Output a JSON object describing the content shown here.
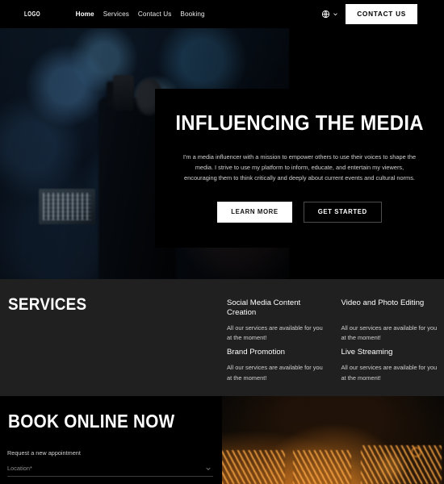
{
  "header": {
    "logo": "LOGO",
    "nav": [
      {
        "label": "Home",
        "active": true
      },
      {
        "label": "Services",
        "active": false
      },
      {
        "label": "Contact Us",
        "active": false
      },
      {
        "label": "Booking",
        "active": false
      }
    ],
    "language_icon": "globe-icon",
    "language_chevron_icon": "chevron-down-icon",
    "cta_label": "CONTACT US"
  },
  "hero": {
    "title": "INFLUENCING THE MEDIA",
    "description": "I'm a media influencer with a mission to empower others to use their voices to shape the media. I strive to use my platform to inform, educate, and entertain my viewers, encouraging them to think critically and deeply about current events and cultural norms.",
    "primary_button": "LEARN MORE",
    "secondary_button": "GET STARTED",
    "image_alt": "blurred-video-camera-bokeh-photo"
  },
  "services": {
    "title": "SERVICES",
    "items": [
      {
        "name": "Social Media Content Creation",
        "description": "All our services are available for you at the moment!"
      },
      {
        "name": "Video and Photo Editing",
        "description": "All our services are available for you at the moment!"
      },
      {
        "name": "Brand Promotion",
        "description": "All our services are available for you at the moment!"
      },
      {
        "name": "Live Streaming",
        "description": "All our services are available for you at the moment!"
      }
    ]
  },
  "booking": {
    "title": "BOOK ONLINE NOW",
    "subtitle": "Request a new appointment",
    "location_field": {
      "label": "Location*",
      "chevron_icon": "chevron-down-icon"
    },
    "image_alt": "dark-orange-stage-lighting-photo"
  },
  "colors": {
    "page_background": "#000000",
    "services_background": "#202020",
    "accent_white": "#ffffff",
    "muted_text": "#cfcfcf",
    "placeholder_text": "#8e8e8e",
    "field_border": "#3a3a3a"
  }
}
